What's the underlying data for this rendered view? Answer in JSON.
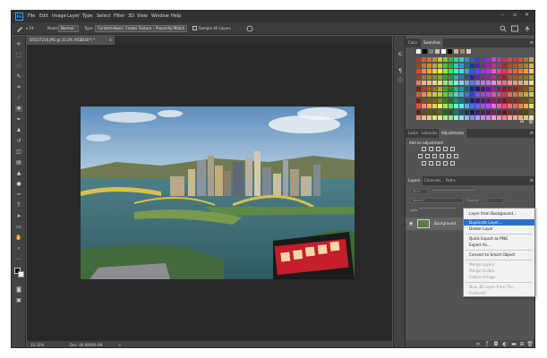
{
  "menubar": {
    "logo": "Ps",
    "items": [
      "File",
      "Edit",
      "Image",
      "Layer",
      "Type",
      "Select",
      "Filter",
      "3D",
      "View",
      "Window",
      "Help"
    ],
    "window_controls": [
      "–",
      "▫",
      "×"
    ]
  },
  "options_bar": {
    "mode_label": "Mode:",
    "mode_value": "Normal",
    "type_label": "Type:",
    "buttons": [
      "Content-Aware",
      "Create Texture",
      "Proximity Match"
    ],
    "sample_all_layers": "Sample All Layers"
  },
  "document": {
    "tab_title": "DSC07216.JPG @ 33.3% (RGB/16*) *",
    "close_glyph": "×"
  },
  "statusbar": {
    "zoom": "33.33%",
    "doc_info": "Doc: 90.6M/90.6M",
    "arrow": ">"
  },
  "panels": {
    "color_tabs": [
      "Color",
      "Swatches"
    ],
    "adjust_tabs": [
      "Learn",
      "Libraries",
      "Adjustments"
    ],
    "adjust_title": "Add an adjustment",
    "layers_tabs": [
      "Layers",
      "Channels",
      "Paths"
    ],
    "filter_label": "Kind",
    "blend_mode": "Normal",
    "opacity_label": "Opacity:",
    "lock_label": "Lock:",
    "fill_label": "Fill:",
    "layer_name": "Background"
  },
  "context_menu": {
    "items": [
      {
        "label": "Layer from Background...",
        "state": "normal"
      },
      {
        "label": "Duplicate Layer...",
        "state": "highlighted"
      },
      {
        "label": "Delete Layer",
        "state": "normal"
      },
      {
        "label": "Quick Export as PNG",
        "state": "normal"
      },
      {
        "label": "Export As...",
        "state": "normal"
      },
      {
        "label": "Convert to Smart Object",
        "state": "normal"
      },
      {
        "label": "Merge Layers",
        "state": "disabled"
      },
      {
        "label": "Merge Visible",
        "state": "disabled"
      },
      {
        "label": "Flatten Image",
        "state": "disabled"
      },
      {
        "label": "New 3D Layer from File...",
        "state": "disabled"
      },
      {
        "label": "Postcard",
        "state": "disabled"
      }
    ]
  },
  "colors": {
    "accent_blue": "#2a6fd0",
    "app_dark": "#323232",
    "panel_gray": "#535353"
  }
}
